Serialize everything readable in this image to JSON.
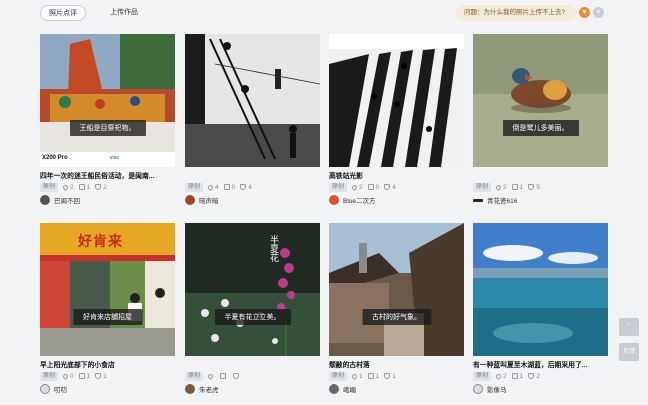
{
  "tabs": [
    {
      "label": "照片点评"
    },
    {
      "label": "上传作品"
    }
  ],
  "question": {
    "text": "问题：为什么我的照片上传不上去?",
    "icon": "help-icon",
    "close_icon": "close-icon"
  },
  "cards": [
    {
      "title": "四年一次的迷王船民俗活动，是闽南...",
      "caption": "王船是目祭祀物。",
      "tag": "原创",
      "likes": "2",
      "comments": "1",
      "thumbs": "2",
      "author": "巴闽不回",
      "watermark_left": "X200 Pro",
      "watermark_right": "vivo"
    },
    {
      "title": "",
      "caption": "",
      "tag": "原创",
      "likes": "4",
      "comments": "0",
      "thumbs": "4",
      "author": "晓声暗"
    },
    {
      "title": "高铁站光影",
      "caption": "",
      "tag": "原创",
      "likes": "2",
      "comments": "0",
      "thumbs": "4",
      "author": "Blue二次方"
    },
    {
      "title": "",
      "caption": "倒是鹭儿多美丽。",
      "tag": "原创",
      "likes": "2",
      "comments": "1",
      "thumbs": "5",
      "author": "青花瓷616"
    },
    {
      "title": "早上阳光底部下的小食店",
      "caption": "好肯来店舖招屋",
      "tag": "原创",
      "likes": "0",
      "comments": "1",
      "thumbs": "1",
      "author": "叨叨",
      "sign_text": "好肯来"
    },
    {
      "title": "",
      "caption": "半夏有花立立美。",
      "tag": "原创",
      "likes": "",
      "comments": "",
      "thumbs": "",
      "author": "朱老虎",
      "vertical_text": "半夏花"
    },
    {
      "title": "颓敝的古村落",
      "caption": "古村的好气象。",
      "tag": "原创",
      "likes": "1",
      "comments": "1",
      "thumbs": "1",
      "author": "峨嵋"
    },
    {
      "title": "有一种蓝叫夏至木湖蓝，后期采用了...",
      "caption": "",
      "tag": "原创",
      "likes": "2",
      "comments": "1",
      "thumbs": "2",
      "author": "影像马"
    }
  ],
  "side": {
    "top_label": "⌃",
    "bottom_label": "反馈"
  },
  "colors": {
    "accent": "#f08b2e",
    "question_bg": "#f6ead9",
    "page_bg": "#f2f3f5"
  }
}
